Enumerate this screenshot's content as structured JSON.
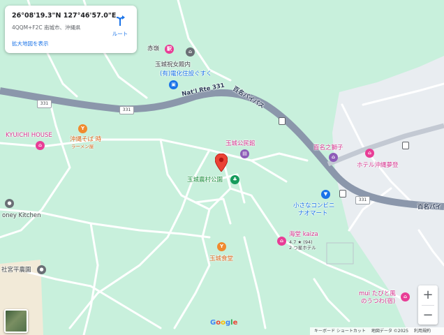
{
  "info_card": {
    "coordinates": "26°08'19.3\"N 127°46'57.0\"E",
    "plus_code": "4QQM+F2C 南城市、沖縄県",
    "directions_label": "ルート",
    "larger_map_link": "拡大地図を表示",
    "icon": "directions-turn-icon"
  },
  "roads": {
    "route_shield": "331",
    "route_name_en": "Nat'l Rte 331",
    "bypass_name": "百名バイパス",
    "bypass_name_right": "百名バイ"
  },
  "places": [
    {
      "id": "akamine",
      "name": "赤嶺",
      "sub": "",
      "color": "pink",
      "icon": "train-station-icon"
    },
    {
      "id": "tamagusuku-iwai",
      "name": "玉城祝女殿内",
      "sub": "",
      "color": "gray",
      "icon": "landmark-icon"
    },
    {
      "id": "denka",
      "name": "(有)電化住設ぐすく",
      "sub": "",
      "color": "blue",
      "icon": "shopping-bag-icon"
    },
    {
      "id": "kyuichi",
      "name": "KYUICHI HOUSE",
      "sub": "",
      "color": "pink",
      "icon": "hotel-icon"
    },
    {
      "id": "soba",
      "name": "沖縄そば 時",
      "sub": "ラーメン屋",
      "color": "orange",
      "icon": "restaurant-icon"
    },
    {
      "id": "kominkan",
      "name": "玉城公民館",
      "sub": "",
      "color": "pink",
      "icon": "building-icon"
    },
    {
      "id": "nouson-park",
      "name": "玉城農村公園",
      "sub": "",
      "color": "green",
      "icon": "park-icon"
    },
    {
      "id": "hyakuna-shishi",
      "name": "百名之獅子",
      "sub": "",
      "color": "pink",
      "icon": "landmark-icon"
    },
    {
      "id": "hotel-okinawa",
      "name": "ホテル沖縄夢登",
      "sub": "",
      "color": "pink",
      "icon": "hotel-icon"
    },
    {
      "id": "ocean-kitchen",
      "name": "oney Kitchen",
      "sub": "",
      "color": "gray",
      "icon": "location-icon"
    },
    {
      "id": "konbini",
      "name": "小さなコンビニ",
      "sub": "ナオマート",
      "color": "blue",
      "icon": "shopping-cart-icon"
    },
    {
      "id": "umidou",
      "name": "海堂 kaiza",
      "sub": "4.7 ★ (94)",
      "sub2": "2 つ星ホテル",
      "color": "pink",
      "icon": "hotel-icon"
    },
    {
      "id": "shokudo",
      "name": "玉城食堂",
      "sub": "",
      "color": "orange",
      "icon": "restaurant-icon"
    },
    {
      "id": "heiyachi",
      "name": "社宮平農園",
      "sub": "",
      "color": "gray",
      "icon": "location-icon"
    },
    {
      "id": "muitabi",
      "name": "mui たびと風",
      "sub": "のうつわ(宿)",
      "color": "pink",
      "icon": "hotel-icon"
    }
  ],
  "controls": {
    "zoom_in": "+",
    "zoom_out": "−",
    "google_logo": "Google",
    "footer": {
      "shortcuts": "キーボード ショートカット",
      "map_data": "地図データ ©2025",
      "terms": "利用規約"
    }
  },
  "colors": {
    "land": "#c8f0dc",
    "urban": "#e9edf1",
    "highway": "#8b97ab",
    "road": "#ffffff",
    "marker": "#ea4335"
  }
}
